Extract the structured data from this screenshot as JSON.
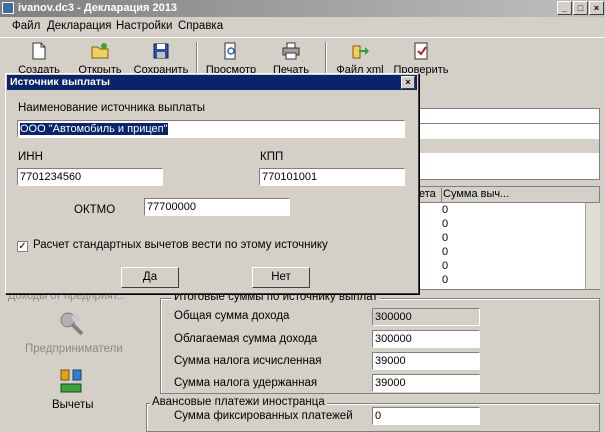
{
  "window": {
    "title": "ivanov.dc3 - Декларация 2013"
  },
  "menu": [
    "Файл",
    "Декларация",
    "Настройки",
    "Справка"
  ],
  "toolbar": {
    "create": "Создать",
    "open": "Открыть",
    "save": "Сохранить",
    "preview": "Просмотр",
    "print": "Печать",
    "xml": "Файл xml",
    "check": "Проверить"
  },
  "dialog": {
    "title": "Источник выплаты",
    "source_label": "Наименование источника выплаты",
    "source_value": "ООО \"Автомобиль и прицеп\"",
    "inn_label": "ИНН",
    "inn_value": "7701234560",
    "kpp_label": "КПП",
    "kpp_value": "770101001",
    "oktmo_label": "ОКТМО",
    "oktmo_value": "77700000",
    "checkbox_label": "Расчет стандартных вычетов вести по этому источнику",
    "yes": "Да",
    "no": "Нет"
  },
  "bg_table": {
    "col1": "ета",
    "col2": "Сумма выч...",
    "values": [
      "0",
      "0",
      "0",
      "0",
      "0",
      "0",
      "0"
    ]
  },
  "sidebar": {
    "partial": "Доходы от предприят...",
    "entrepreneurs": "Предприниматели",
    "deductions": "Вычеты"
  },
  "totals": {
    "title": "Итоговые суммы по источнику выплат",
    "total_income_label": "Общая сумма дохода",
    "total_income_value": "300000",
    "taxable_income_label": "Облагаемая сумма дохода",
    "taxable_income_value": "300000",
    "tax_calc_label": "Сумма налога исчисленная",
    "tax_calc_value": "39000",
    "tax_withheld_label": "Сумма налога удержанная",
    "tax_withheld_value": "39000"
  },
  "advance": {
    "title": "Авансовые платежи иностранца",
    "fixed_label": "Сумма фиксированных платежей",
    "fixed_value": "0"
  }
}
